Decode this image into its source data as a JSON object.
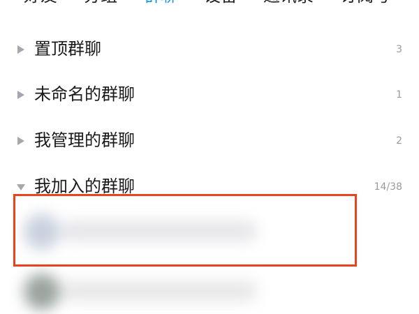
{
  "tabs": [
    {
      "label": "好友"
    },
    {
      "label": "分组"
    },
    {
      "label": "群聊"
    },
    {
      "label": "设备"
    },
    {
      "label": "通讯录"
    },
    {
      "label": "订阅号"
    }
  ],
  "active_tab_index": 2,
  "groups": [
    {
      "title": "置顶群聊",
      "count": "3",
      "expanded": false
    },
    {
      "title": "未命名的群聊",
      "count": "1",
      "expanded": false
    },
    {
      "title": "我管理的群聊",
      "count": "2",
      "expanded": false
    },
    {
      "title": "我加入的群聊",
      "count": "14/38",
      "expanded": true
    }
  ],
  "colors": {
    "accent": "#1296db",
    "highlight": "#e8421f",
    "text": "#1a1a1a",
    "muted": "#9a9a9a"
  },
  "icons": {
    "collapsed": "triangle-right-icon",
    "expanded": "triangle-down-icon"
  }
}
